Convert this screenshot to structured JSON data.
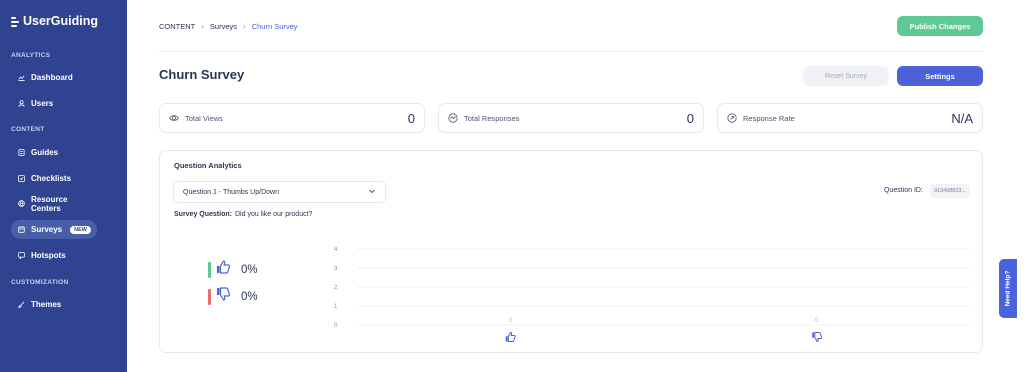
{
  "app": {
    "logo_text": "UserGuiding"
  },
  "sidebar": {
    "sections": [
      {
        "label": "ANALYTICS"
      },
      {
        "label": "CONTENT"
      },
      {
        "label": "CUSTOMIZATION"
      }
    ],
    "items": [
      {
        "label": "Dashboard",
        "icon": "chart-icon"
      },
      {
        "label": "Users",
        "icon": "user-icon"
      },
      {
        "label": "Guides",
        "icon": "guide-icon"
      },
      {
        "label": "Checklists",
        "icon": "checklist-icon"
      },
      {
        "label": "Resource Centers",
        "icon": "globe-icon"
      },
      {
        "label": "Surveys",
        "icon": "survey-icon",
        "badge": "NEW",
        "active": true
      },
      {
        "label": "Hotspots",
        "icon": "hotspot-icon"
      },
      {
        "label": "Themes",
        "icon": "brush-icon"
      }
    ]
  },
  "breadcrumb": {
    "items": [
      "CONTENT",
      "Surveys",
      "Churn Survey"
    ]
  },
  "header": {
    "publish_label": "Publish Changes",
    "title": "Churn Survey",
    "reset_label": "Reset Survey",
    "settings_label": "Settings"
  },
  "stats": [
    {
      "label": "Total Views",
      "value": "0",
      "icon": "eye-icon"
    },
    {
      "label": "Total Responses",
      "value": "0",
      "icon": "responses-icon"
    },
    {
      "label": "Response Rate",
      "value": "N/A",
      "icon": "rate-icon"
    }
  ],
  "analytics": {
    "title": "Question Analytics",
    "selected_question": "Question 1 - Thumbs Up/Down",
    "question_id_label": "Question ID:",
    "question_id_value": "913498823...",
    "survey_question_label": "Survey Question:",
    "survey_question_text": "Did you like our product?",
    "legend": [
      {
        "label": "Thumbs Up",
        "percent": "0%",
        "color": "#5ec995",
        "icon": "thumbs-up-icon"
      },
      {
        "label": "Thumbs Down",
        "percent": "0%",
        "color": "#ef6b6b",
        "icon": "thumbs-down-icon"
      }
    ]
  },
  "chart_data": {
    "type": "bar",
    "categories": [
      "thumbs-up",
      "thumbs-down"
    ],
    "values": [
      0,
      0
    ],
    "value_labels": [
      "0",
      "0"
    ],
    "y_ticks": [
      "0",
      "1",
      "2",
      "3",
      "4"
    ],
    "ylim": [
      0,
      4
    ],
    "grid": true,
    "title": "",
    "xlabel": "",
    "ylabel": ""
  },
  "help": {
    "label": "Need Help?"
  },
  "colors": {
    "sidebar": "#2f4391",
    "primary": "#4c62d9",
    "publish": "#5ec995",
    "positive": "#5ec995",
    "negative": "#ef6b6b"
  }
}
